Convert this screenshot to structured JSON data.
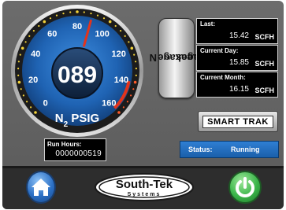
{
  "gauge": {
    "value": 89,
    "value_display": "089",
    "min": 0,
    "max": 160,
    "ticks": [
      "0",
      "20",
      "40",
      "60",
      "80",
      "100",
      "120",
      "140",
      "160"
    ],
    "unit_main": "N",
    "unit_sub": "2",
    "unit_suffix": " PSIG"
  },
  "side_label": {
    "line1_main": "N",
    "line1_sub": "2",
    "line1_suffix": " Leakage",
    "line2": "Averages"
  },
  "averages": [
    {
      "label": "Last:",
      "value": "15.42",
      "unit": "SCFH"
    },
    {
      "label": "Current Day:",
      "value": "15.85",
      "unit": "SCFH"
    },
    {
      "label": "Current Month:",
      "value": "16.15",
      "unit": "SCFH"
    }
  ],
  "smarttrak": {
    "label": "SMART TRAK"
  },
  "run_hours": {
    "label": "Run Hours:",
    "value": "0000000519"
  },
  "status": {
    "label": "Status:",
    "value": "Running"
  },
  "logo": {
    "line1": "South-Tek",
    "line2": "Systems"
  },
  "colors": {
    "gauge_face": "#1f63b3",
    "needle": "#e2341c",
    "status_bg": "#2a78cc",
    "home_button": "#2b6fc4",
    "power_button": "#3bb54a"
  },
  "icons": {
    "home": "home-icon",
    "power": "power-icon"
  }
}
